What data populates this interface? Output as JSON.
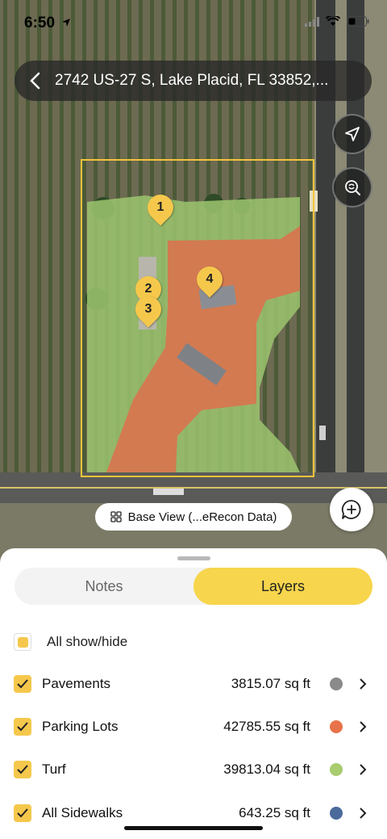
{
  "status_bar": {
    "time": "6:50"
  },
  "header": {
    "address": "2742 US-27 S, Lake Placid, FL 33852,..."
  },
  "map": {
    "markers": [
      {
        "label": "1"
      },
      {
        "label": "2"
      },
      {
        "label": "3"
      },
      {
        "label": "4"
      }
    ],
    "base_view_label": "Base View (...eRecon Data)"
  },
  "tabs": {
    "notes": "Notes",
    "layers": "Layers"
  },
  "layers": {
    "all_label": "All show/hide",
    "items": [
      {
        "name": "Pavements",
        "area": "3815.07 sq ft",
        "color": "#8a8a8a"
      },
      {
        "name": "Parking Lots",
        "area": "42785.55 sq ft",
        "color": "#e8734a"
      },
      {
        "name": "Turf",
        "area": "39813.04 sq ft",
        "color": "#a8cc6e"
      },
      {
        "name": "All Sidewalks",
        "area": "643.25 sq ft",
        "color": "#4a6a9c"
      }
    ]
  },
  "colors": {
    "accent": "#f7d54c",
    "checkbox": "#f5c84c"
  }
}
